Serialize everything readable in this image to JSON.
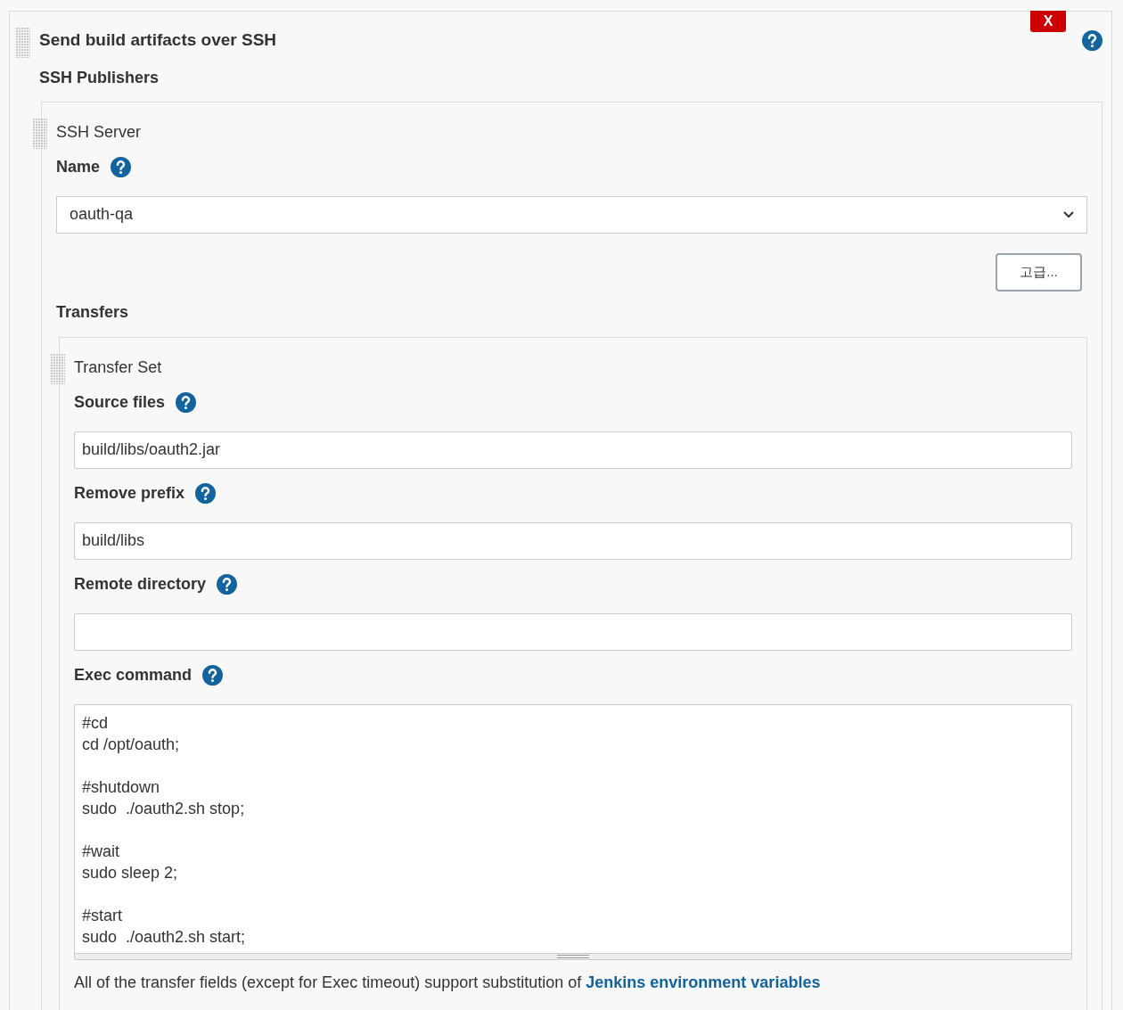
{
  "section": {
    "title": "Send build artifacts over SSH",
    "delete_button": "X",
    "subtitle": "SSH Publishers"
  },
  "server": {
    "heading": "SSH Server",
    "name_label": "Name",
    "name_value": "oauth-qa",
    "advanced_button": "고급..."
  },
  "transfers": {
    "label": "Transfers",
    "set_heading": "Transfer Set",
    "fields": [
      {
        "kind": "text",
        "label": "Source files",
        "value": "build/libs/oauth2.jar"
      },
      {
        "kind": "text",
        "label": "Remove prefix",
        "value": "build/libs"
      },
      {
        "kind": "text",
        "label": "Remote directory"
      },
      {
        "kind": "textarea",
        "label": "Exec command",
        "value": "#cd\ncd /opt/oauth;\n\n#shutdown\nsudo  ./oauth2.sh stop;\n\n#wait\nsudo sleep 2;\n\n#start\nsudo  ./oauth2.sh start;"
      }
    ]
  },
  "footer": {
    "text": "All of the transfer fields (except for Exec timeout) support substitution of",
    "link": "Jenkins environment variables"
  }
}
